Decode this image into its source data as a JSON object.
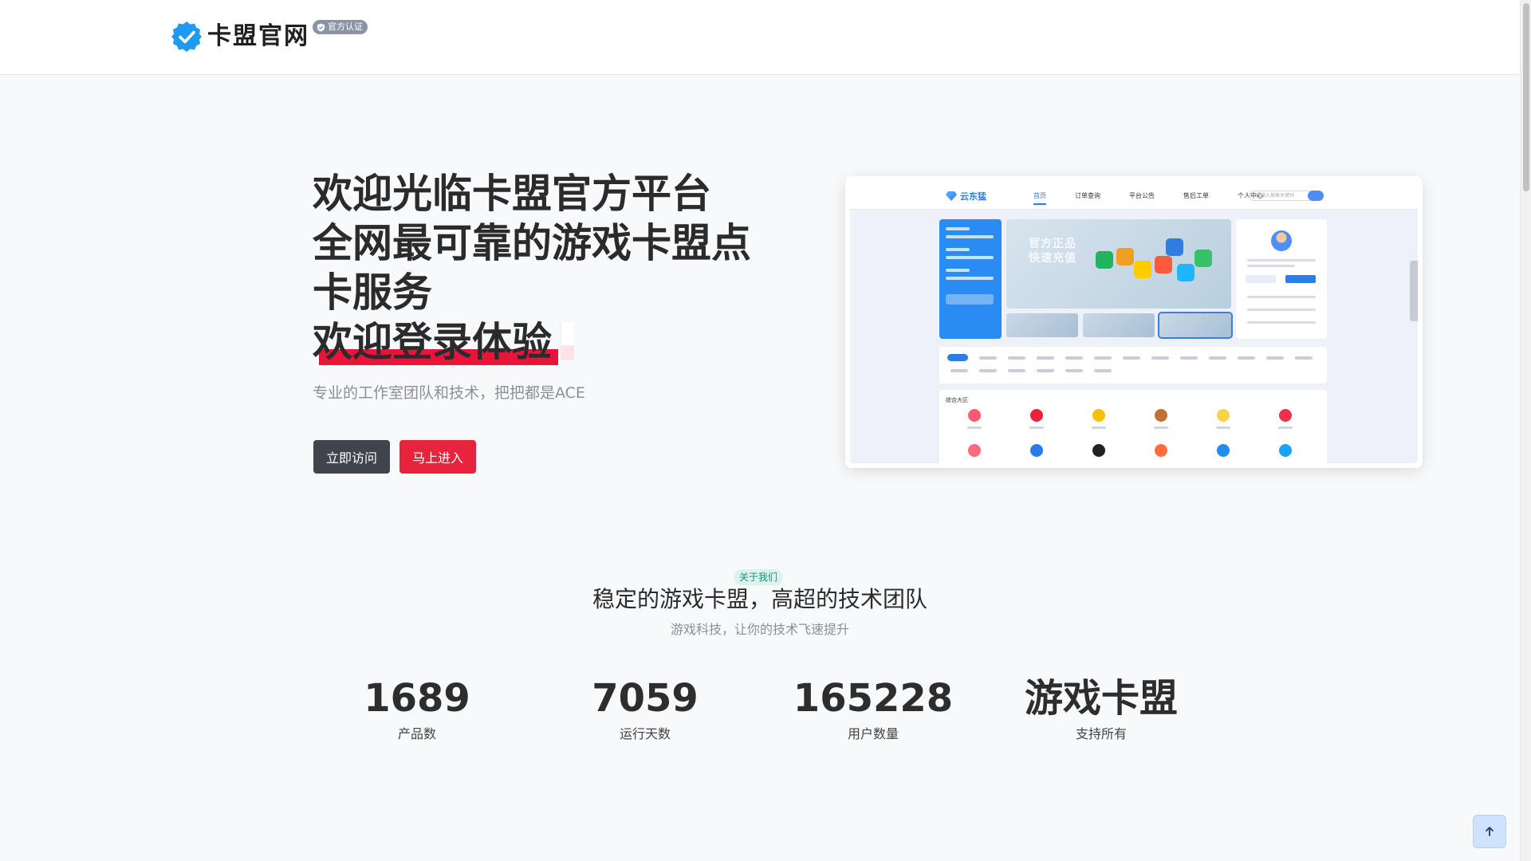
{
  "header": {
    "brand": "卡盟官网",
    "badge": "官方认证"
  },
  "hero": {
    "title_lines": [
      "欢迎光临卡盟官方平台",
      "全网最可靠的游戏卡盟点",
      "卡服务"
    ],
    "typed_text": "欢迎登录体验",
    "subtitle": "专业的工作室团队和技术，把把都是ACE",
    "primary_button": "立即访问",
    "secondary_button": "马上进入"
  },
  "preview": {
    "logo": "云东猛",
    "menu": [
      "首页",
      "订单查询",
      "平台公告",
      "售后工单",
      "个人中心"
    ],
    "search_placeholder": "请输入搜索关键词",
    "banner_text": [
      "官方正品",
      "快速充值"
    ],
    "section_title": "综合大区"
  },
  "about": {
    "badge": "关于我们",
    "title": "稳定的游戏卡盟，高超的技术团队",
    "subtitle": "游戏科技，让你的技术飞速提升",
    "stats": [
      {
        "value": "1689",
        "label": "产品数"
      },
      {
        "value": "7059",
        "label": "运行天数"
      },
      {
        "value": "165228",
        "label": "用户数量"
      },
      {
        "value": "游戏卡盟",
        "label": "支持所有"
      }
    ]
  },
  "colors": {
    "brand_blue": "#1e9af0",
    "accent_red": "#e8243c",
    "dark_button": "#3f444d",
    "badge_teal": "#1d8f7a"
  },
  "icons": {
    "logo": "verified-check-icon",
    "badge": "shield-check-icon",
    "back_to_top": "arrow-up-icon"
  }
}
